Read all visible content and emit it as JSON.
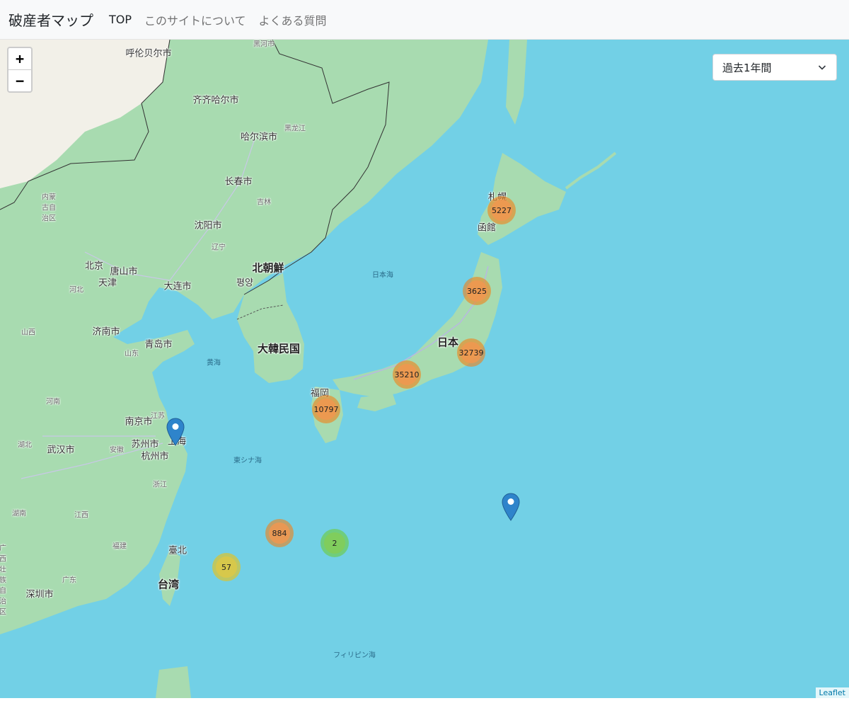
{
  "navbar": {
    "brand": "破産者マップ",
    "links": [
      "TOP",
      "このサイトについて",
      "よくある質問"
    ]
  },
  "map": {
    "zoom_in": "+",
    "zoom_out": "−",
    "period_select": {
      "selected": "過去1年間"
    },
    "attribution": "Leaflet",
    "labels": {
      "cities": [
        "呼伦贝尔市",
        "齐齐哈尔市",
        "哈尔滨市",
        "长春市",
        "沈阳市",
        "北京",
        "唐山市",
        "天津",
        "大连市",
        "평양",
        "济南市",
        "青岛市",
        "南京市",
        "苏州市",
        "上海",
        "杭州市",
        "武汉市",
        "臺北",
        "深圳市",
        "札幌",
        "函館",
        "福岡"
      ],
      "provinces": [
        "黑河市",
        "黑龙江",
        "吉林",
        "辽宁",
        "内蒙古自治区",
        "河北",
        "山西",
        "山东",
        "河南",
        "江苏",
        "安徽",
        "湖北",
        "浙江",
        "江西",
        "湖南",
        "福建",
        "广东",
        "广西壮族自治区"
      ],
      "countries": [
        "北朝鮮",
        "大韓民国",
        "日本",
        "台湾"
      ],
      "seas": [
        "日本海",
        "黄海",
        "東シナ海",
        "フィリピン海"
      ]
    },
    "clusters": [
      {
        "count": "5227",
        "color": "orange"
      },
      {
        "count": "3625",
        "color": "orange"
      },
      {
        "count": "32739",
        "color": "orange"
      },
      {
        "count": "35210",
        "color": "orange"
      },
      {
        "count": "10797",
        "color": "orange"
      },
      {
        "count": "884",
        "color": "orange"
      },
      {
        "count": "2",
        "color": "green"
      },
      {
        "count": "57",
        "color": "yellow"
      }
    ],
    "markers": [
      "marker-icon",
      "marker-icon"
    ],
    "colors": {
      "sea": "#72d0e6",
      "land": "#a8dbb0",
      "cluster_orange": "#f18017",
      "cluster_yellow": "#f0c20c",
      "cluster_green": "#6ecc39",
      "marker": "#2e84cb"
    }
  }
}
